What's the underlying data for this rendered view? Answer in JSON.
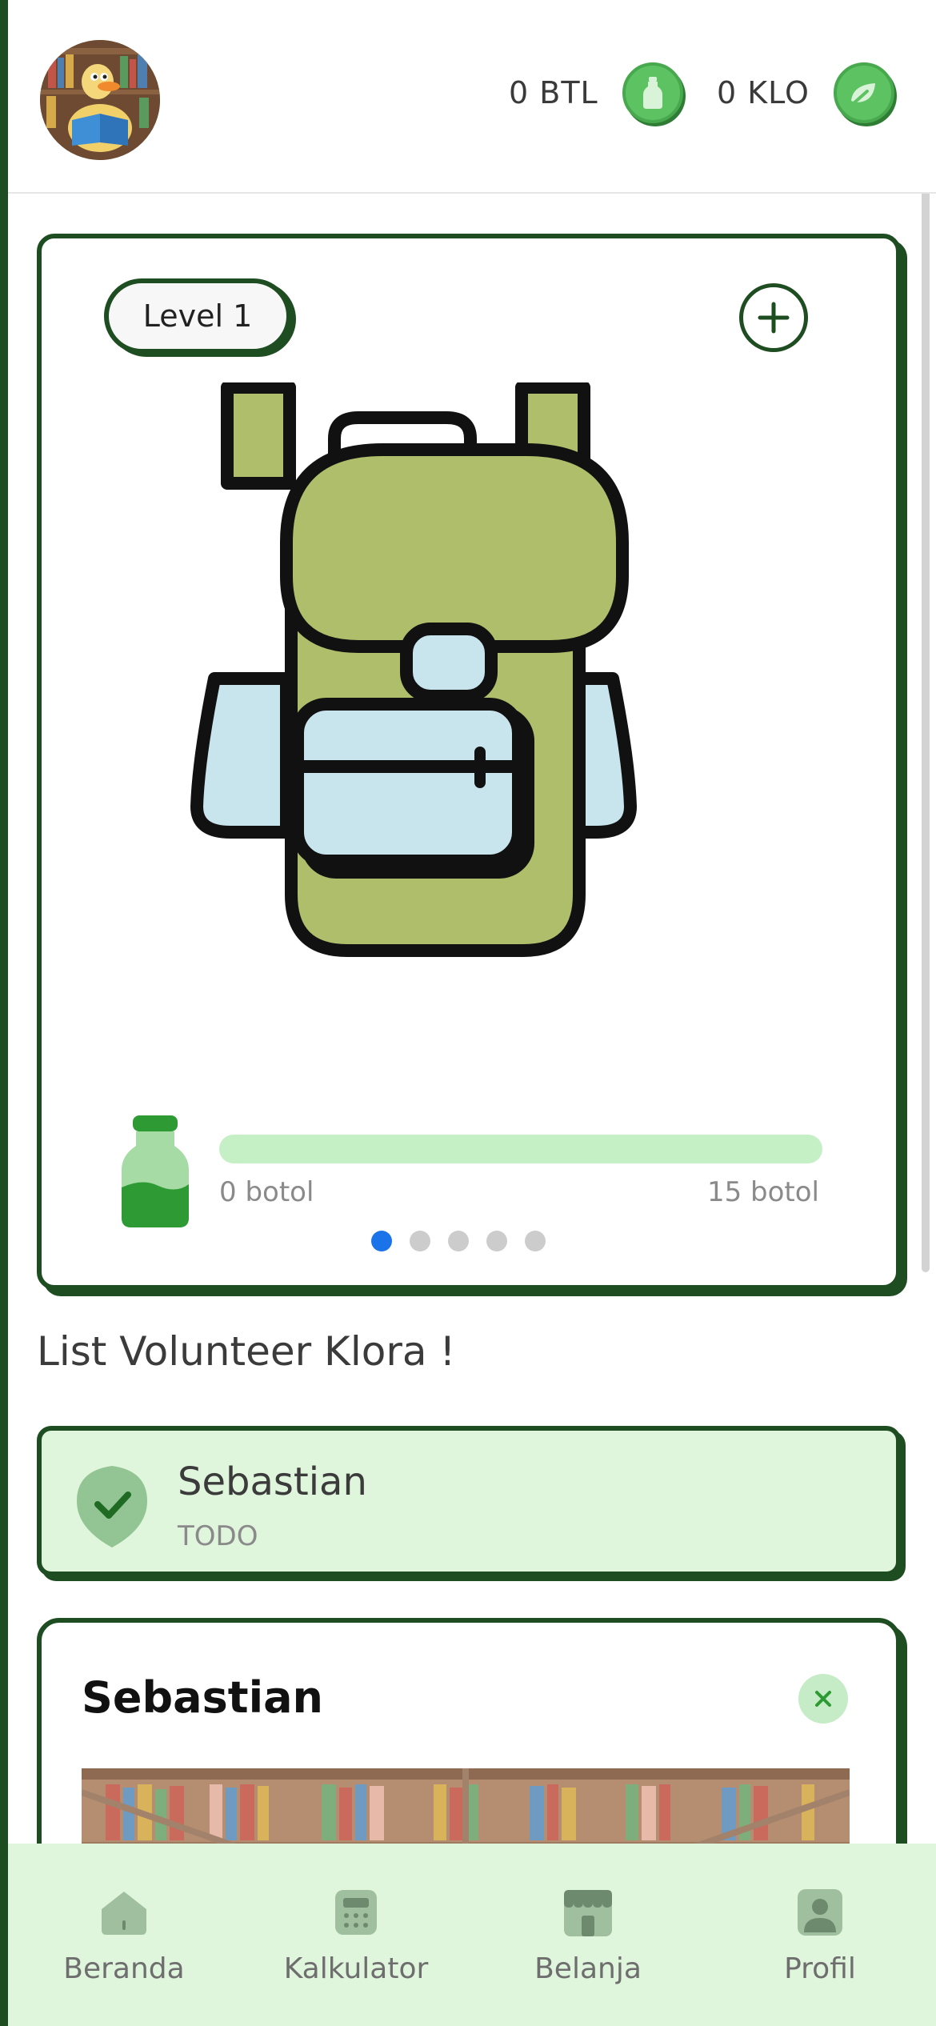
{
  "header": {
    "btl_label": "0 BTL",
    "klo_label": "0 KLO"
  },
  "main_card": {
    "level_label": "Level 1",
    "progress": {
      "min_label": "0 botol",
      "max_label": "15 botol",
      "fraction": 0
    },
    "carousel": {
      "total": 5,
      "active_index": 0
    }
  },
  "section_title": "List Volunteer Klora !",
  "volunteer_item": {
    "name": "Sebastian",
    "status": "TODO"
  },
  "detail_card": {
    "title": "Sebastian"
  },
  "nav": {
    "items": [
      {
        "label": "Beranda",
        "icon": "home-icon"
      },
      {
        "label": "Kalkulator",
        "icon": "calculator-icon"
      },
      {
        "label": "Belanja",
        "icon": "shop-icon"
      },
      {
        "label": "Profil",
        "icon": "profile-icon"
      }
    ]
  },
  "colors": {
    "accent_dark_green": "#1f4d22",
    "light_green_bg": "#dff5dc",
    "coin_green": "#5cc262",
    "carousel_active": "#1a73e8"
  }
}
